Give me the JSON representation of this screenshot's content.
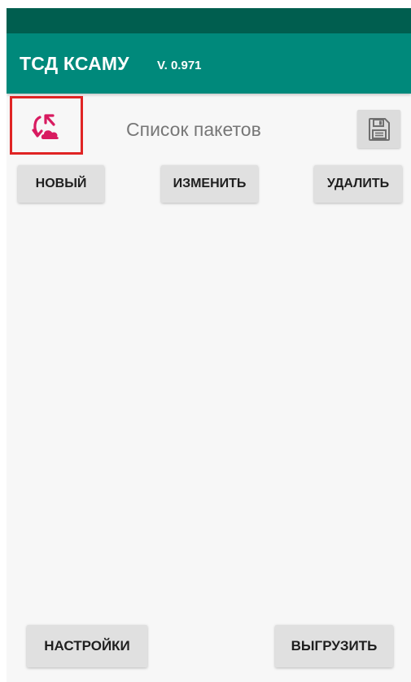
{
  "app_bar": {
    "title": "ТСД КСАМУ",
    "version": "V. 0.971"
  },
  "header": {
    "title": "Список пакетов",
    "sync_icon": "cloud-sync-icon",
    "save_icon": "floppy-disk-icon"
  },
  "actions": {
    "new_label": "НОВЫЙ",
    "edit_label": "ИЗМЕНИТЬ",
    "delete_label": "УДАЛИТЬ"
  },
  "footer": {
    "settings_label": "НАСТРОЙКИ",
    "export_label": "ВЫГРУЗИТЬ"
  },
  "colors": {
    "status_bar": "#005e4f",
    "app_bar": "#00897b",
    "sync_icon": "#d81b60",
    "highlight_box": "#e02424",
    "button_bg": "#e0e0e0",
    "background": "#f7f7f7"
  },
  "packages": []
}
